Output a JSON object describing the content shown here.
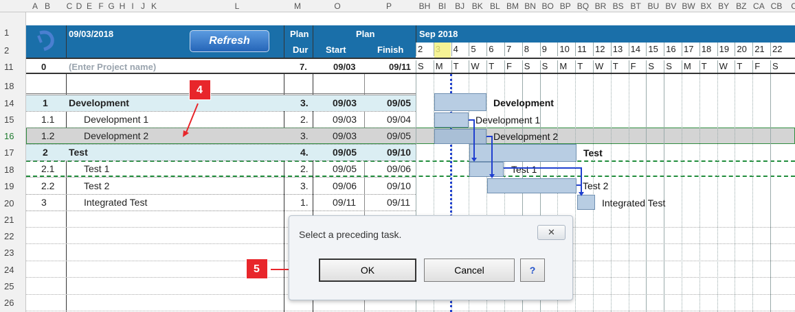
{
  "sheet": {
    "column_letters": [
      "A",
      "B",
      "C",
      "D",
      "E",
      "F",
      "G",
      "H",
      "I",
      "J",
      "K",
      "L",
      "M",
      "O",
      "P",
      "BH",
      "BI",
      "BJ",
      "BK",
      "BL",
      "BM",
      "BN",
      "BO",
      "BP",
      "BQ",
      "BR",
      "BS",
      "BT",
      "BU",
      "BV",
      "BW",
      "BX",
      "BY",
      "BZ",
      "CA",
      "CB",
      "C"
    ],
    "row_numbers": [
      "1",
      "2",
      "11",
      "18",
      "14",
      "15",
      "16",
      "17",
      "18",
      "19",
      "20",
      "21",
      "22",
      "23",
      "24",
      "25",
      "26"
    ],
    "header": {
      "date": "09/03/2018",
      "refresh_label": "Refresh",
      "plan_dur_top": "Plan",
      "plan_dur_bottom": "Dur",
      "plan_group": "Plan",
      "start": "Start",
      "finish": "Finish",
      "month": "Sep 2018",
      "days": [
        "2",
        "3",
        "4",
        "5",
        "6",
        "7",
        "8",
        "9",
        "10",
        "11",
        "12",
        "13",
        "14",
        "15",
        "16",
        "17",
        "18",
        "19",
        "20",
        "21",
        "22"
      ],
      "weekdays": [
        "S",
        "M",
        "T",
        "W",
        "T",
        "F",
        "S",
        "S",
        "M",
        "T",
        "W",
        "T",
        "F",
        "S",
        "S",
        "M",
        "T",
        "W",
        "T",
        "F",
        "S"
      ]
    },
    "project_row": {
      "id": "0",
      "name": "(Enter Project name)",
      "dur": "7.",
      "start": "09/03",
      "finish": "09/11"
    },
    "tasks": [
      {
        "id": "1",
        "name": "Development",
        "dur": "3.",
        "start": "09/03",
        "finish": "09/05",
        "bold": true
      },
      {
        "id": "1.1",
        "name": "Development 1",
        "dur": "2.",
        "start": "09/03",
        "finish": "09/04",
        "bold": false
      },
      {
        "id": "1.2",
        "name": "Development 2",
        "dur": "3.",
        "start": "09/03",
        "finish": "09/05",
        "bold": false
      },
      {
        "id": "2",
        "name": "Test",
        "dur": "4.",
        "start": "09/05",
        "finish": "09/10",
        "bold": true
      },
      {
        "id": "2.1",
        "name": "Test 1",
        "dur": "2.",
        "start": "09/05",
        "finish": "09/06",
        "bold": false
      },
      {
        "id": "2.2",
        "name": "Test 2",
        "dur": "3.",
        "start": "09/06",
        "finish": "09/10",
        "bold": false
      },
      {
        "id": "3",
        "name": "Integrated Test",
        "dur": "1.",
        "start": "09/11",
        "finish": "09/11",
        "bold": false
      }
    ],
    "gantt_labels": [
      "Development",
      "Development 1",
      "Development 2",
      "Test",
      "Test 1",
      "Test 2",
      "Integrated Test"
    ]
  },
  "callouts": {
    "step4": "4",
    "step5": "5"
  },
  "dialog": {
    "message": "Select a preceding task.",
    "ok_label": "OK",
    "cancel_label": "Cancel",
    "help_label": "?",
    "close_glyph": "✕"
  },
  "colors": {
    "header_blue": "#1a6fa9",
    "today_col": "#f3f07a",
    "bar_fill": "#b8cde3",
    "callout_red": "#e8262b",
    "group_row": "#dbeef3",
    "selected_row": "#c8c8c8"
  }
}
